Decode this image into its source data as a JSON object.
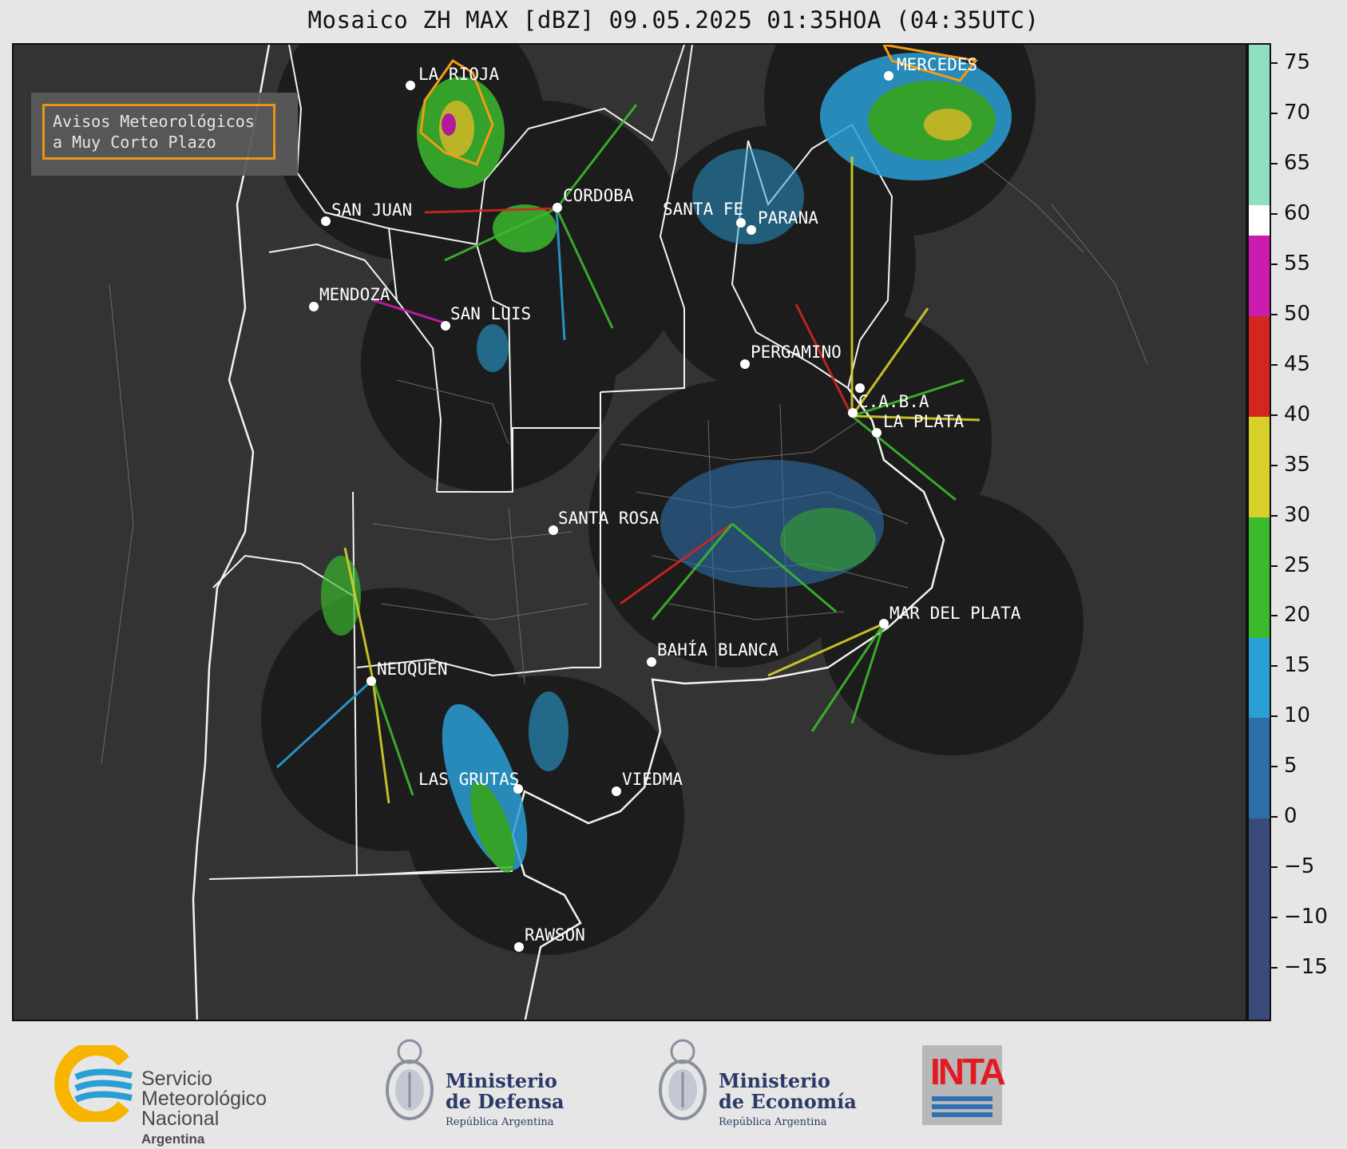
{
  "title": "Mosaico ZH MAX [dBZ] 09.05.2025 01:35HOA (04:35UTC)",
  "alert_box": {
    "line1": "Avisos Meteorológicos",
    "line2": "a Muy Corto Plazo",
    "border_color": "#f39c12"
  },
  "cities": [
    {
      "name": "LA RIOJA",
      "label": "LA RIOJA"
    },
    {
      "name": "MERCEDES",
      "label": "MERCEDES"
    },
    {
      "name": "CORDOBA",
      "label": "CORDOBA"
    },
    {
      "name": "SAN JUAN",
      "label": "SAN JUAN"
    },
    {
      "name": "SANTA FE",
      "label": "SANTA FE"
    },
    {
      "name": "PARANA",
      "label": "PARANA"
    },
    {
      "name": "MENDOZA",
      "label": "MENDOZA"
    },
    {
      "name": "SAN LUIS",
      "label": "SAN LUIS"
    },
    {
      "name": "PERGAMINO",
      "label": "PERGAMINO"
    },
    {
      "name": "CABA",
      "label": "C.A.B.A"
    },
    {
      "name": "LA PLATA",
      "label": "LA PLATA"
    },
    {
      "name": "SANTA ROSA",
      "label": "SANTA ROSA"
    },
    {
      "name": "MAR DEL PLATA",
      "label": "MAR DEL PLATA"
    },
    {
      "name": "BAHIA BLANCA",
      "label": "BAHÍA BLANCA"
    },
    {
      "name": "NEUQUEN",
      "label": "NEUQUÉN"
    },
    {
      "name": "LAS GRUTAS",
      "label": "LAS GRUTAS"
    },
    {
      "name": "VIEDMA",
      "label": "VIEDMA"
    },
    {
      "name": "RAWSON",
      "label": "RAWSON"
    }
  ],
  "colorbar": {
    "unit": "dBZ",
    "ticks": [
      "75",
      "70",
      "65",
      "60",
      "55",
      "50",
      "45",
      "40",
      "35",
      "30",
      "25",
      "20",
      "15",
      "10",
      "5",
      "0",
      "−5",
      "−10",
      "−15"
    ],
    "tick_values": [
      75,
      70,
      65,
      60,
      55,
      50,
      45,
      40,
      35,
      30,
      25,
      20,
      15,
      10,
      5,
      0,
      -5,
      -10,
      -15
    ],
    "range": [
      -20,
      77
    ],
    "colors": [
      {
        "from": -20,
        "to": 0,
        "color": "#3a4a7a"
      },
      {
        "from": 0,
        "to": 10,
        "color": "#2e6fa8"
      },
      {
        "from": 10,
        "to": 18,
        "color": "#2a9fd6"
      },
      {
        "from": 18,
        "to": 30,
        "color": "#3cba2e"
      },
      {
        "from": 30,
        "to": 40,
        "color": "#d8d02a"
      },
      {
        "from": 40,
        "to": 50,
        "color": "#d2261f"
      },
      {
        "from": 50,
        "to": 58,
        "color": "#cc1cb0"
      },
      {
        "from": 58,
        "to": 61,
        "color": "#ffffff"
      },
      {
        "from": 61,
        "to": 77,
        "color": "#8fe0c0"
      }
    ]
  },
  "logos": {
    "smn": {
      "line1": "Servicio",
      "line2": "Meteorológico",
      "line3": "Nacional",
      "line4": "Argentina"
    },
    "defensa": {
      "line1": "Ministerio",
      "line2": "de Defensa",
      "line3": "República Argentina"
    },
    "economia": {
      "line1": "Ministerio",
      "line2": "de Economía",
      "line3": "República Argentina"
    },
    "inta": {
      "text": "INTA"
    }
  }
}
